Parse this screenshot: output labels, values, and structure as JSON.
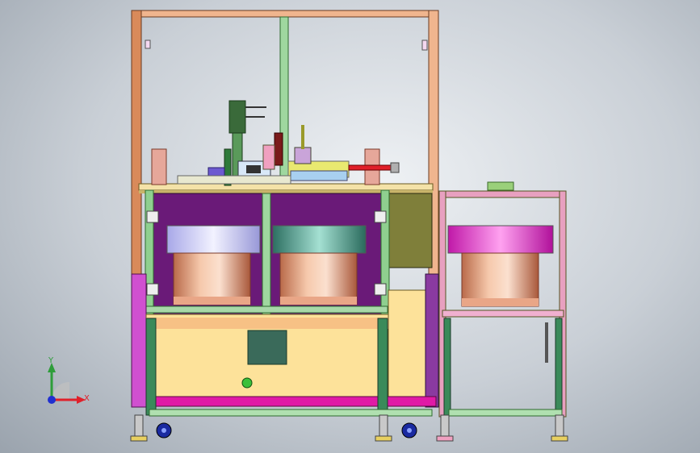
{
  "triad": {
    "x_label": "X",
    "y_label": "Y",
    "x_color": "#e0202a",
    "y_color": "#2e9d3a",
    "z_color": "#2030d0"
  },
  "colors": {
    "frame_orange": "#d98a5a",
    "frame_green": "#8fcf8f",
    "frame_pink": "#e8a0c0",
    "panel_purple": "#6a1a78",
    "panel_olive": "#7f7f3a",
    "cabinet_yellow": "#fde29a",
    "bowl_lavender": "#c8c8f5",
    "bowl_teal": "#3a8a7a",
    "bowl_magenta": "#e020c8",
    "bowl_copper": "#e3a080",
    "magenta_bar": "#e01aa6"
  },
  "components": {
    "feeder_bowls": 3,
    "casters": 4
  }
}
